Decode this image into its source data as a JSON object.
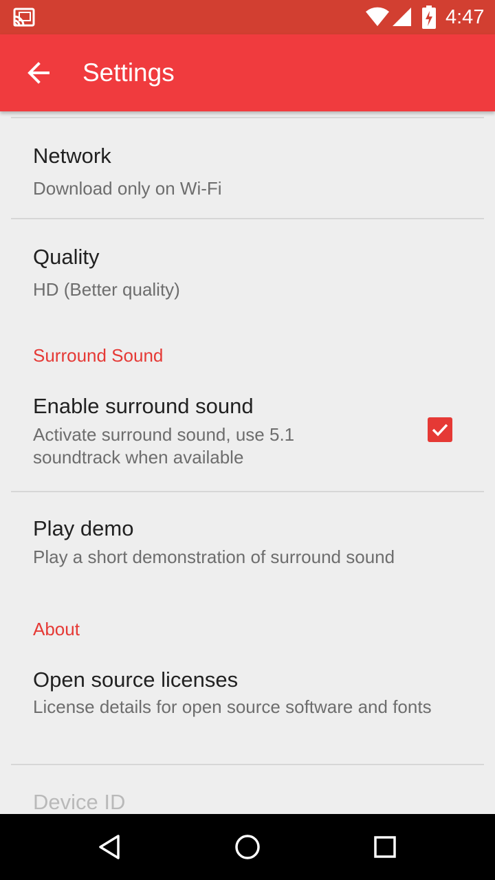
{
  "status_bar": {
    "time": "4:47",
    "icons": [
      "cast-icon",
      "wifi-icon",
      "signal-icon",
      "battery-charging-icon"
    ]
  },
  "toolbar": {
    "title": "Settings",
    "back_icon": "arrow-back-icon",
    "color": "#f03b3e"
  },
  "preferences": {
    "network": {
      "title": "Network",
      "summary": "Download only on Wi-Fi"
    },
    "quality": {
      "title": "Quality",
      "summary": "HD (Better quality)"
    },
    "surround_category": "Surround Sound",
    "enable_surround": {
      "title": "Enable surround sound",
      "summary": "Activate surround sound, use 5.1 soundtrack when available",
      "checked": true
    },
    "play_demo": {
      "title": "Play demo",
      "summary": "Play a short demonstration of surround sound"
    },
    "about_category": "About",
    "licenses": {
      "title": "Open source licenses",
      "summary": "License details for open source software and fonts"
    },
    "device_id": {
      "title": "Device ID"
    }
  },
  "colors": {
    "accent": "#e53935",
    "status_bar": "#d23f31"
  },
  "nav_bar": {
    "icons": [
      "back-triangle-icon",
      "home-circle-icon",
      "recents-square-icon"
    ]
  }
}
